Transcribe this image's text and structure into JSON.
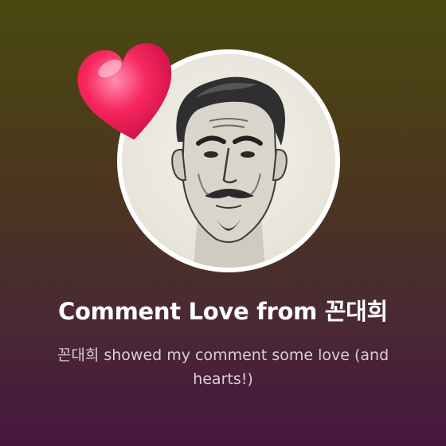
{
  "notification": {
    "title": "Comment Love from 꼰대희",
    "message": "꼰대희 showed my comment some love (and hearts!)"
  },
  "avatar": {
    "icon": "caricature-avatar",
    "ring_color": "#ffffff"
  },
  "heart": {
    "icon": "heart-icon",
    "color": "#f0245a"
  },
  "colors": {
    "background_top": "#4a4a10",
    "background_bottom": "#47163f",
    "title": "#ffffff",
    "message": "#d8cfd4"
  }
}
